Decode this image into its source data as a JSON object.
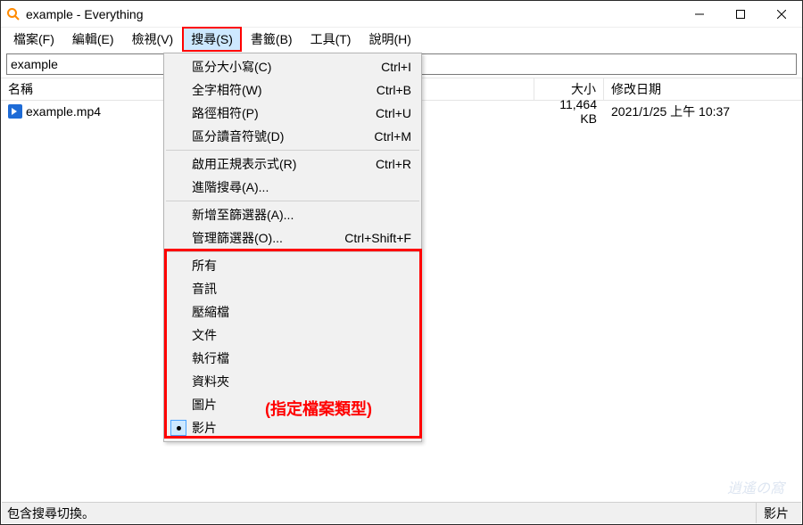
{
  "window": {
    "title": "example - Everything"
  },
  "menubar": {
    "file": "檔案(F)",
    "edit": "編輯(E)",
    "view": "檢視(V)",
    "search": "搜尋(S)",
    "bookmarks": "書籤(B)",
    "tools": "工具(T)",
    "help": "說明(H)"
  },
  "search_input": {
    "value": "example"
  },
  "columns": {
    "name": "名稱",
    "size": "大小",
    "date": "修改日期"
  },
  "results": [
    {
      "name": "example.mp4",
      "size": "11,464 KB",
      "date": "2021/1/25 上午 10:37"
    }
  ],
  "dropdown": {
    "items": [
      {
        "label": "區分大小寫(C)",
        "shortcut": "Ctrl+I"
      },
      {
        "label": "全字相符(W)",
        "shortcut": "Ctrl+B"
      },
      {
        "label": "路徑相符(P)",
        "shortcut": "Ctrl+U"
      },
      {
        "label": "區分讀音符號(D)",
        "shortcut": "Ctrl+M"
      }
    ],
    "items2": [
      {
        "label": "啟用正規表示式(R)",
        "shortcut": "Ctrl+R"
      },
      {
        "label": "進階搜尋(A)...",
        "shortcut": ""
      }
    ],
    "items3": [
      {
        "label": "新增至篩選器(A)...",
        "shortcut": ""
      },
      {
        "label": "管理篩選器(O)...",
        "shortcut": "Ctrl+Shift+F"
      }
    ],
    "filters": [
      {
        "label": "所有",
        "checked": false
      },
      {
        "label": "音訊",
        "checked": false
      },
      {
        "label": "壓縮檔",
        "checked": false
      },
      {
        "label": "文件",
        "checked": false
      },
      {
        "label": "執行檔",
        "checked": false
      },
      {
        "label": "資料夾",
        "checked": false
      },
      {
        "label": "圖片",
        "checked": false
      },
      {
        "label": "影片",
        "checked": true
      }
    ]
  },
  "annotation": {
    "filter_hint": "(指定檔案類型)"
  },
  "statusbar": {
    "left": "包含搜尋切換。",
    "right": "影片"
  }
}
